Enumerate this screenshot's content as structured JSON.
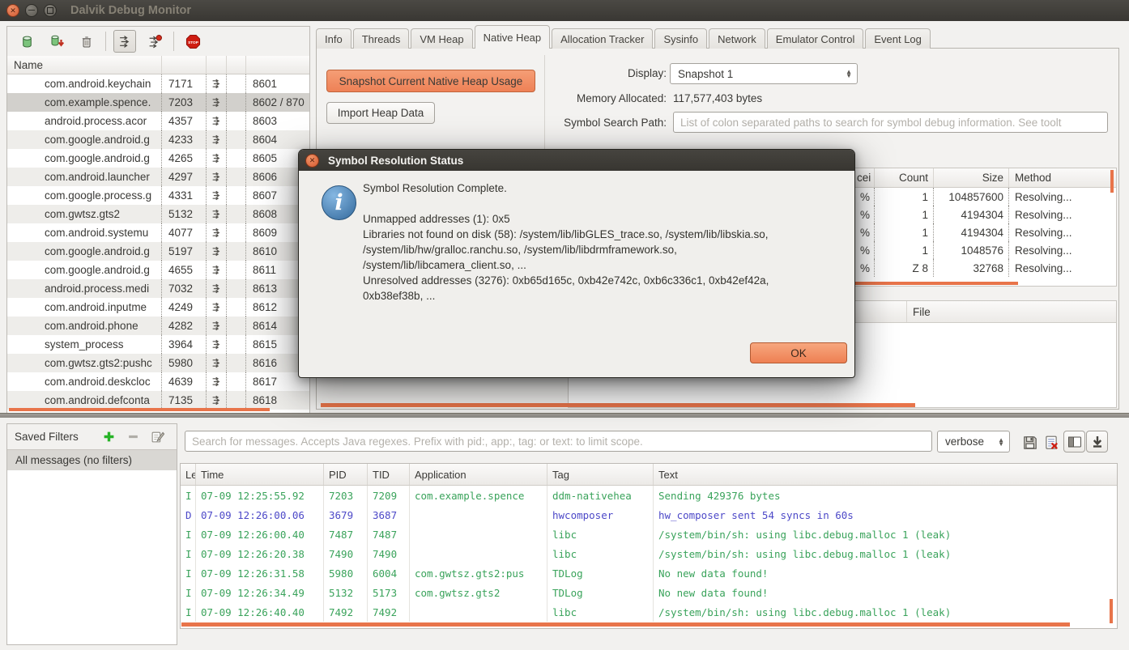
{
  "window": {
    "title": "Dalvik Debug Monitor",
    "controls": [
      "close-icon",
      "minimize-icon",
      "maximize-icon"
    ]
  },
  "colors": {
    "accent_orange": "#e8744a",
    "button_orange": "#ee8156",
    "titlebar_dark": "#3c3a35",
    "log_green": "#3aa35b",
    "log_blue": "#4d49c8",
    "info_icon_blue": "#33699c"
  },
  "device_panel": {
    "toolbar_icons": [
      "show-heap-updates",
      "dump-hprof",
      "cause-gc",
      "update-threads",
      "start-method-profiling",
      "stop-process"
    ],
    "header": "Name",
    "processes": [
      {
        "name": "com.android.keychain",
        "pid": "7171",
        "port": "8601"
      },
      {
        "name": "com.example.spence.",
        "pid": "7203",
        "port": "8602 / 870",
        "selected": true
      },
      {
        "name": "android.process.acor",
        "pid": "4357",
        "port": "8603"
      },
      {
        "name": "com.google.android.g",
        "pid": "4233",
        "port": "8604"
      },
      {
        "name": "com.google.android.g",
        "pid": "4265",
        "port": "8605"
      },
      {
        "name": "com.android.launcher",
        "pid": "4297",
        "port": "8606"
      },
      {
        "name": "com.google.process.g",
        "pid": "4331",
        "port": "8607"
      },
      {
        "name": "com.gwtsz.gts2",
        "pid": "5132",
        "port": "8608"
      },
      {
        "name": "com.android.systemu",
        "pid": "4077",
        "port": "8609"
      },
      {
        "name": "com.google.android.g",
        "pid": "5197",
        "port": "8610"
      },
      {
        "name": "com.google.android.g",
        "pid": "4655",
        "port": "8611"
      },
      {
        "name": "android.process.medi",
        "pid": "7032",
        "port": "8613"
      },
      {
        "name": "com.android.inputme",
        "pid": "4249",
        "port": "8612"
      },
      {
        "name": "com.android.phone",
        "pid": "4282",
        "port": "8614"
      },
      {
        "name": "system_process",
        "pid": "3964",
        "port": "8615"
      },
      {
        "name": "com.gwtsz.gts2:pushc",
        "pid": "5980",
        "port": "8616"
      },
      {
        "name": "com.android.deskcloc",
        "pid": "4639",
        "port": "8617"
      },
      {
        "name": "com.android.defconta",
        "pid": "7135",
        "port": "8618"
      }
    ]
  },
  "tabs": {
    "items": [
      {
        "label": "Info"
      },
      {
        "label": "Threads"
      },
      {
        "label": "VM Heap"
      },
      {
        "label": "Native Heap",
        "active": true
      },
      {
        "label": "Allocation Tracker"
      },
      {
        "label": "Sysinfo"
      },
      {
        "label": "Network"
      },
      {
        "label": "Emulator Control"
      },
      {
        "label": "Event Log"
      }
    ]
  },
  "native_heap": {
    "snapshot_button": "Snapshot Current Native Heap Usage",
    "import_button": "Import Heap Data",
    "display_label": "Display:",
    "display_value": "Snapshot 1",
    "memory_label": "Memory Allocated:",
    "memory_value": "117,577,403 bytes",
    "symbol_label": "Symbol Search Path:",
    "symbol_placeholder": "List of colon separated paths to search for symbol debug information. See toolt"
  },
  "alloc_table": {
    "header_fragment": "cei",
    "columns": {
      "count": "Count",
      "size": "Size",
      "method": "Method"
    },
    "rows": [
      {
        "pct": "%",
        "count": "1",
        "size": "104857600",
        "method": "Resolving..."
      },
      {
        "pct": "%",
        "count": "1",
        "size": "4194304",
        "method": "Resolving..."
      },
      {
        "pct": "%",
        "count": "1",
        "size": "4194304",
        "method": "Resolving..."
      },
      {
        "pct": "%",
        "count": "1",
        "size": "1048576",
        "method": "Resolving..."
      },
      {
        "pct": "%",
        "count": "Z 8",
        "size": "32768",
        "method": "Resolving..."
      }
    ]
  },
  "file_panel": {
    "header": "File"
  },
  "dialog": {
    "title": "Symbol Resolution Status",
    "complete": "Symbol Resolution Complete.",
    "unmapped": "Unmapped addresses (1): 0x5",
    "libraries": "Libraries not found on disk (58): /system/lib/libGLES_trace.so, /system/lib/libskia.so, /system/lib/hw/gralloc.ranchu.so, /system/lib/libdrmframework.so, /system/lib/libcamera_client.so, ...",
    "unresolved": "Unresolved addresses (3276): 0xb65d165c, 0xb42e742c, 0xb6c336c1, 0xb42ef42a, 0xb38ef38b, ...",
    "ok": "OK"
  },
  "logcat": {
    "saved_filters_title": "Saved Filters",
    "filter_icons": [
      "add-filter",
      "remove-filter",
      "edit-filter"
    ],
    "filter_item": "All messages (no filters)",
    "search_placeholder": "Search for messages. Accepts Java regexes. Prefix with pid:, app:, tag: or text: to limit scope.",
    "level_value": "verbose",
    "toolbar_icons": [
      "save-log",
      "clear-log",
      "toggle-filters-pane",
      "scroll-to-bottom"
    ],
    "columns": [
      "Le",
      "Time",
      "PID",
      "TID",
      "Application",
      "Tag",
      "Text"
    ],
    "rows": [
      {
        "level": "I",
        "time": "07-09 12:25:55.92",
        "pid": "7203",
        "tid": "7209",
        "app": "com.example.spence",
        "tag": "ddm-nativehea",
        "text": "Sending 429376 bytes",
        "color": "green"
      },
      {
        "level": "D",
        "time": "07-09 12:26:00.06",
        "pid": "3679",
        "tid": "3687",
        "app": "",
        "tag": "hwcomposer",
        "text": "hw_composer sent 54 syncs in 60s",
        "color": "blue"
      },
      {
        "level": "I",
        "time": "07-09 12:26:00.40",
        "pid": "7487",
        "tid": "7487",
        "app": "",
        "tag": "libc",
        "text": "/system/bin/sh: using libc.debug.malloc 1 (leak)",
        "color": "green"
      },
      {
        "level": "I",
        "time": "07-09 12:26:20.38",
        "pid": "7490",
        "tid": "7490",
        "app": "",
        "tag": "libc",
        "text": "/system/bin/sh: using libc.debug.malloc 1 (leak)",
        "color": "green"
      },
      {
        "level": "I",
        "time": "07-09 12:26:31.58",
        "pid": "5980",
        "tid": "6004",
        "app": "com.gwtsz.gts2:pus",
        "tag": "TDLog",
        "text": "No new data found!",
        "color": "green"
      },
      {
        "level": "I",
        "time": "07-09 12:26:34.49",
        "pid": "5132",
        "tid": "5173",
        "app": "com.gwtsz.gts2",
        "tag": "TDLog",
        "text": "No new data found!",
        "color": "green"
      },
      {
        "level": "I",
        "time": "07-09 12:26:40.40",
        "pid": "7492",
        "tid": "7492",
        "app": "",
        "tag": "libc",
        "text": "/system/bin/sh: using libc.debug.malloc 1 (leak)",
        "color": "green"
      }
    ]
  }
}
